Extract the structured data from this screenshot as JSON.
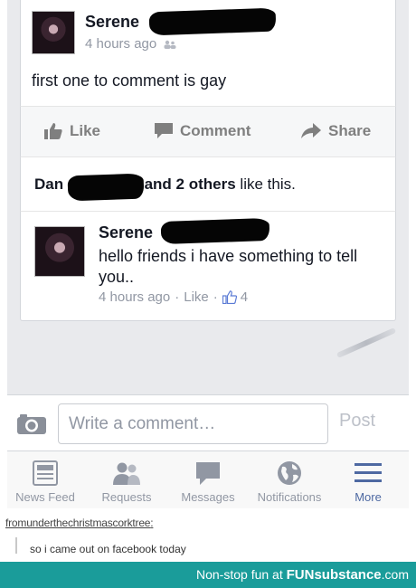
{
  "post": {
    "author": "Serene",
    "time": "4 hours ago",
    "text": "first one to comment is gay",
    "actions": {
      "like": "Like",
      "comment": "Comment",
      "share": "Share"
    }
  },
  "likes": {
    "first_name": "Dan",
    "others": "and 2 others",
    "suffix": " like this."
  },
  "comment": {
    "author": "Serene",
    "text": "hello friends i have something to tell you..",
    "time": "4 hours ago",
    "like": "Like",
    "like_count": "4"
  },
  "composer": {
    "placeholder": "Write a comment…",
    "post_label": "Post"
  },
  "tabs": [
    {
      "label": "News Feed",
      "icon": "news-feed-icon"
    },
    {
      "label": "Requests",
      "icon": "friend-requests-icon"
    },
    {
      "label": "Messages",
      "icon": "messages-icon"
    },
    {
      "label": "Notifications",
      "icon": "globe-icon"
    },
    {
      "label": "More",
      "icon": "menu-icon"
    }
  ],
  "caption": {
    "username": "fromunderthechristmascorktree",
    "username_suffix": ":",
    "text": "so i came out on facebook today"
  },
  "footer": {
    "prefix": "Non-stop fun at",
    "brand": "FUNsubstance",
    "tld": ".com"
  },
  "colors": {
    "feed_background": "#e9eaed",
    "active_tab": "#4e69a2",
    "footer_background": "#1a9c9a"
  }
}
